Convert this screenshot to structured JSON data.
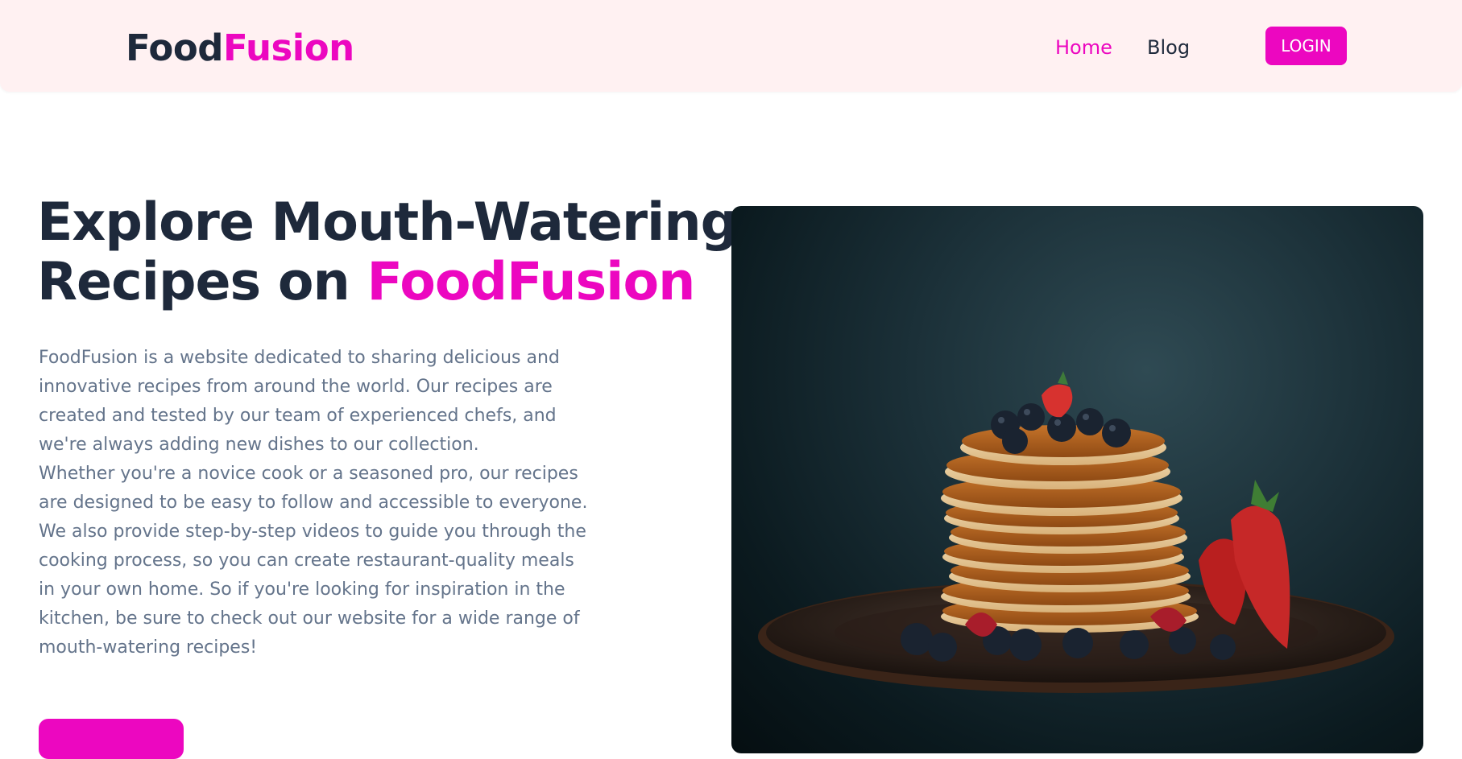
{
  "header": {
    "logo": {
      "part1": "Food",
      "part2": "Fusion"
    },
    "nav": {
      "home": "Home",
      "blog": "Blog"
    },
    "login_label": "LOGIN"
  },
  "hero": {
    "title_line1": "Explore Mouth-Watering",
    "title_line2_prefix": "Recipes on ",
    "title_line2_accent": "FoodFusion",
    "paragraph1": "FoodFusion is a website dedicated to sharing delicious and innovative recipes from around the world. Our recipes are created and tested by our team of experienced chefs, and we're always adding new dishes to our collection.",
    "paragraph2": "Whether you're a novice cook or a seasoned pro, our recipes are designed to be easy to follow and accessible to everyone. We also provide step-by-step videos to guide you through the cooking process, so you can create restaurant-quality meals in your own home. So if you're looking for inspiration in the kitchen, be sure to check out our website for a wide range of mouth-watering recipes!"
  },
  "image": {
    "subject": "pancake-stack-photo"
  },
  "colors": {
    "brand_pink": "#ec07c0",
    "dark_text": "#1e293b",
    "muted_text": "#64748b",
    "nav_background": "#fff1f2"
  }
}
